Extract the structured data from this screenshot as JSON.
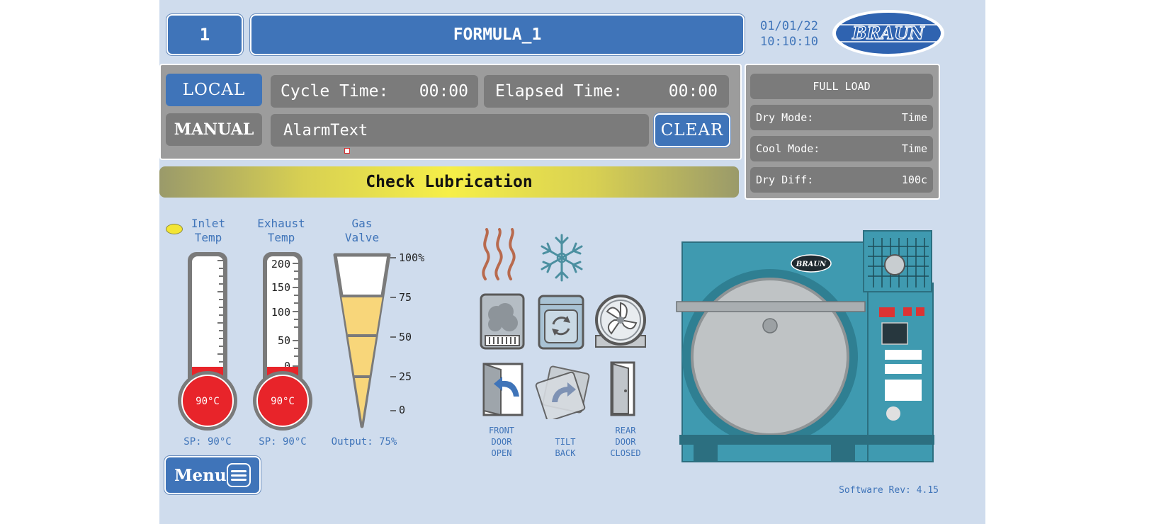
{
  "header": {
    "station_number": "1",
    "formula_name": "FORMULA_1",
    "date": "01/01/22",
    "time": "10:10:10",
    "logo_text": "BRAUN"
  },
  "control": {
    "local_label": "LOCAL",
    "manual_label": "MANUAL",
    "cycle_time_label": "Cycle Time:",
    "cycle_time_value": "00:00",
    "elapsed_time_label": "Elapsed Time:",
    "elapsed_time_value": "00:00",
    "alarm_text": "AlarmText",
    "clear_label": "CLEAR"
  },
  "load_panel": {
    "load_type": "FULL LOAD",
    "rows": [
      {
        "label": "Dry Mode:",
        "value": "Time"
      },
      {
        "label": "Cool Mode:",
        "value": "Time"
      },
      {
        "label": "Dry Diff:",
        "value": "100c"
      }
    ]
  },
  "banner": {
    "message": "Check Lubrication"
  },
  "gauges": {
    "inlet": {
      "label_line1": "Inlet",
      "label_line2": "Temp",
      "bulb_value": "90°C",
      "setpoint": "SP: 90°C",
      "fill_fraction": 0.1
    },
    "exhaust": {
      "label_line1": "Exhaust",
      "label_line2": "Temp",
      "bulb_value": "90°C",
      "setpoint": "SP: 90°C",
      "scale": [
        "200",
        "150",
        "100",
        "50",
        "0"
      ],
      "fill_fraction": 0.1
    },
    "gas": {
      "label_line1": "Gas",
      "label_line2": "Valve",
      "output": "Output: 75%",
      "scale": [
        "100%",
        "75",
        "50",
        "25",
        "0"
      ],
      "output_percent": 75
    }
  },
  "status": {
    "front_door": [
      "FRONT",
      "DOOR",
      "OPEN"
    ],
    "tilt": [
      "TILT",
      "BACK"
    ],
    "rear_door": [
      "REAR",
      "DOOR",
      "CLOSED"
    ]
  },
  "machine": {
    "logo_text": "BRAUN"
  },
  "footer": {
    "menu_label": "Menu",
    "software_rev": "Software Rev: 4.15"
  },
  "colors": {
    "panel_bg": "#cfdced",
    "accent_blue": "#3f74b9",
    "gray": "#7b7b7b",
    "alarm_red": "#e8242a",
    "banner_yellow": "#f4ec48",
    "machine_teal": "#3f9ab0"
  }
}
